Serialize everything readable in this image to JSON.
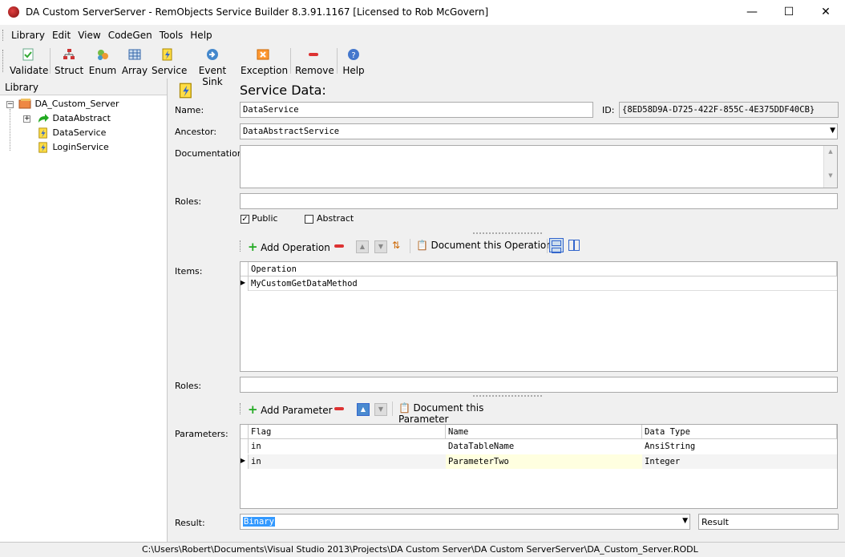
{
  "window": {
    "title": "DA Custom ServerServer - RemObjects Service Builder 8.3.91.1167 [Licensed to Rob McGovern]",
    "controls": {
      "minimize": "—",
      "maximize": "☐",
      "close": "✕"
    }
  },
  "menu": [
    "Library",
    "Edit",
    "View",
    "CodeGen",
    "Tools",
    "Help"
  ],
  "toolbar": [
    {
      "label": "Validate",
      "icon": "validate-icon"
    },
    {
      "label": "Struct",
      "icon": "struct-icon"
    },
    {
      "label": "Enum",
      "icon": "enum-icon"
    },
    {
      "label": "Array",
      "icon": "array-icon"
    },
    {
      "label": "Service",
      "icon": "service-icon"
    },
    {
      "label": "Event Sink",
      "icon": "event-sink-icon"
    },
    {
      "label": "Exception",
      "icon": "exception-icon"
    },
    {
      "label": "Remove",
      "icon": "remove-icon"
    },
    {
      "label": "Help",
      "icon": "help-icon"
    }
  ],
  "library": {
    "header": "Library",
    "root": "DA_Custom_Server",
    "children": [
      "DataAbstract",
      "DataService",
      "LoginService"
    ]
  },
  "form": {
    "heading": "Service Data:",
    "name_label": "Name:",
    "name_value": "DataService",
    "id_label": "ID:",
    "id_value": "{8ED58D9A-D725-422F-855C-4E375DDF40CB}",
    "ancestor_label": "Ancestor:",
    "ancestor_value": "DataAbstractService",
    "documentation_label": "Documentation:",
    "roles_label": "Roles:",
    "public_label": "Public",
    "public_checked": true,
    "abstract_label": "Abstract",
    "abstract_checked": false,
    "items_label": "Items:",
    "add_operation": "Add Operation",
    "document_operation": "Document this Operation",
    "operations_header": "Operation",
    "operations": [
      "MyCustomGetDataMethod"
    ],
    "roles2_label": "Roles:",
    "add_parameter": "Add Parameter",
    "document_parameter": "Document this Parameter",
    "parameters_label": "Parameters:",
    "param_headers": [
      "Flag",
      "Name",
      "Data Type"
    ],
    "params": [
      {
        "flag": "in",
        "name": "DataTableName",
        "type": "AnsiString"
      },
      {
        "flag": "in",
        "name": "ParameterTwo",
        "type": "Integer"
      }
    ],
    "result_label": "Result:",
    "result_type": "Binary",
    "result_name": "Result"
  },
  "status": "C:\\Users\\Robert\\Documents\\Visual Studio 2013\\Projects\\DA Custom Server\\DA Custom ServerServer\\DA_Custom_Server.RODL",
  "colors": {
    "selection": "#3399ff",
    "edit_cell": "#ffffe0"
  }
}
